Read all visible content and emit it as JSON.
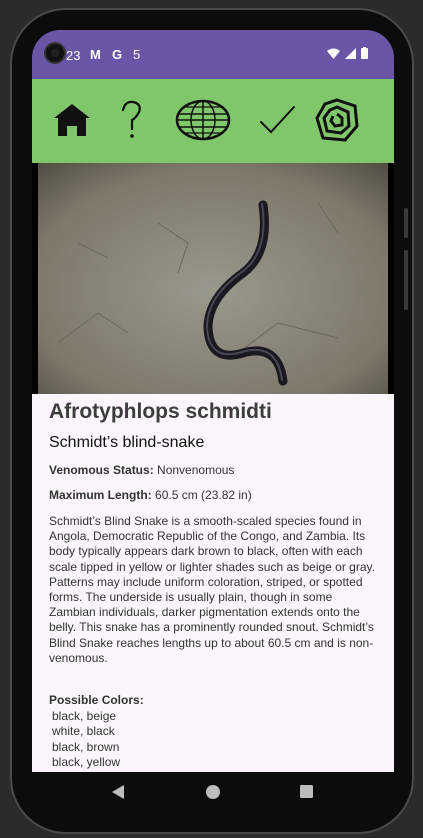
{
  "status_bar": {
    "time": "23",
    "notifications": [
      "M",
      "G",
      "5"
    ]
  },
  "toolbar": {
    "buttons": [
      {
        "name": "home-button",
        "icon": "house-icon"
      },
      {
        "name": "help-button",
        "icon": "question-mark-icon"
      },
      {
        "name": "map-button",
        "icon": "globe-icon"
      },
      {
        "name": "check-button",
        "icon": "checkmark-icon"
      },
      {
        "name": "snake-button",
        "icon": "spiral-snake-icon"
      }
    ]
  },
  "snake": {
    "scientific_name": "Afrotyphlops schmidti",
    "common_name": "Schmidt’s blind-snake",
    "venomous_label": "Venomous Status:",
    "venomous_value": "Nonvenomous",
    "length_label": "Maximum Length:",
    "length_value": "60.5 cm (23.82 in)",
    "description": "Schmidt’s Blind Snake is a smooth-scaled species found in Angola, Democratic Republic of the Congo, and Zambia. Its body typically appears dark brown to black, often with each scale tipped in yellow or lighter shades such as beige or gray. Patterns may include uniform coloration, striped, or spotted forms. The underside is usually plain, though in some Zambian individuals, darker pigmentation extends onto the belly. This snake has a prominently rounded snout. Schmidt’s Blind Snake reaches lengths up to about 60.5 cm and is non-venomous.",
    "colors_label": "Possible Colors:",
    "colors": [
      "black, beige",
      "white, black",
      "black, brown",
      "black, yellow"
    ]
  },
  "theme": {
    "status_bar": "#6a55a6",
    "toolbar": "#80c76c",
    "card": "#fcf5fd"
  }
}
